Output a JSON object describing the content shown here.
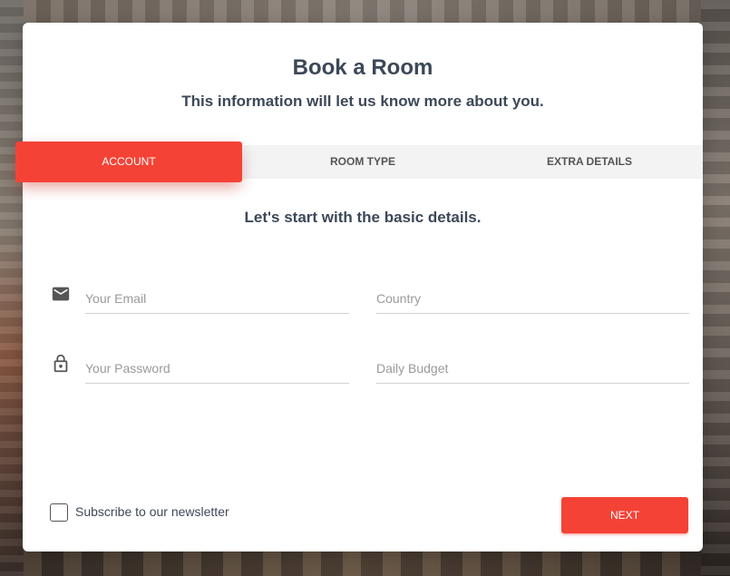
{
  "card": {
    "title": "Book a Room",
    "subtitle": "This information will let us know more about you."
  },
  "tabs": [
    {
      "label": "ACCOUNT",
      "active": true
    },
    {
      "label": "ROOM TYPE",
      "active": false
    },
    {
      "label": "EXTRA DETAILS",
      "active": false
    }
  ],
  "step": {
    "heading": "Let's start with the basic details."
  },
  "form": {
    "email": {
      "placeholder": "Your Email",
      "value": "",
      "icon": "mail-icon"
    },
    "country": {
      "placeholder": "Country",
      "value": ""
    },
    "password": {
      "placeholder": "Your Password",
      "value": "",
      "icon": "lock-icon"
    },
    "budget": {
      "placeholder": "Daily Budget",
      "value": ""
    }
  },
  "newsletter": {
    "label": "Subscribe to our newsletter",
    "checked": false
  },
  "actions": {
    "next_label": "NEXT"
  },
  "colors": {
    "accent": "#f44336",
    "title_text": "#3c4858",
    "tab_bar_bg": "#f3f3f3"
  }
}
